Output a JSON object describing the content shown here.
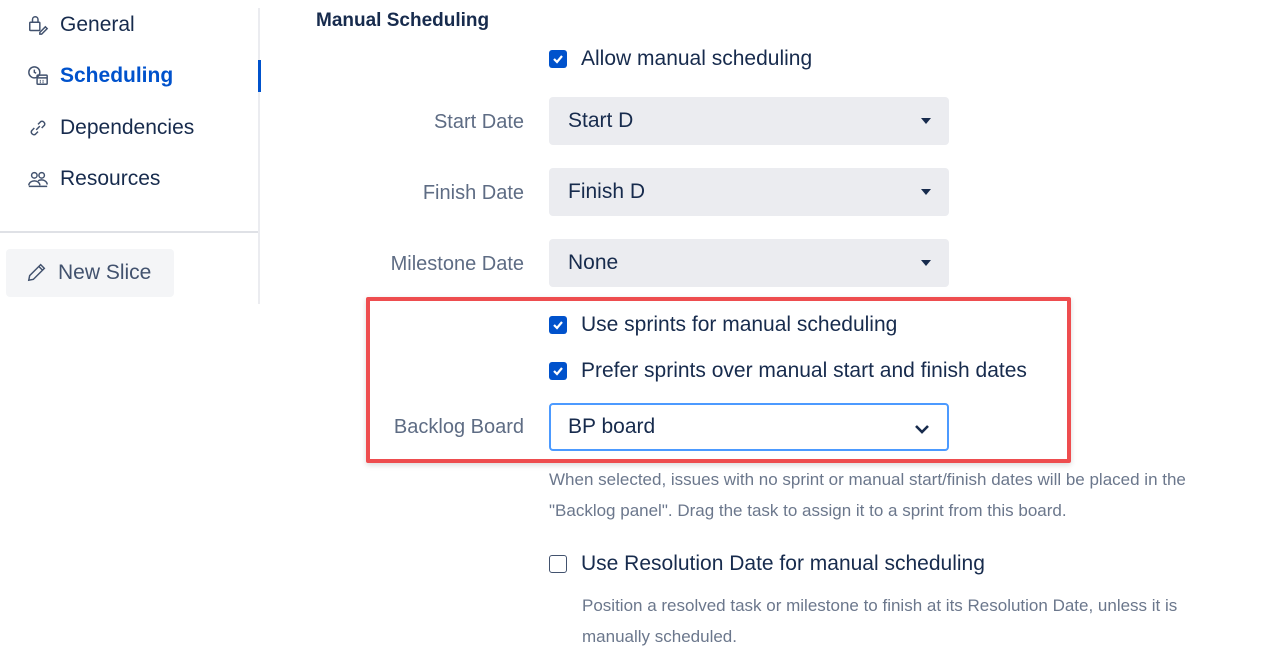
{
  "sidebar": {
    "items": [
      {
        "label": "General",
        "icon": "key-edit-icon"
      },
      {
        "label": "Scheduling",
        "icon": "calendar-clock-icon",
        "active": true
      },
      {
        "label": "Dependencies",
        "icon": "link-icon"
      },
      {
        "label": "Resources",
        "icon": "people-icon"
      }
    ],
    "new_slice_label": "New Slice"
  },
  "main": {
    "section_title": "Manual Scheduling",
    "allow_manual": {
      "label": "Allow manual scheduling",
      "checked": true
    },
    "start_date": {
      "label": "Start Date",
      "value": "Start D"
    },
    "finish_date": {
      "label": "Finish Date",
      "value": "Finish D"
    },
    "milestone_date": {
      "label": "Milestone Date",
      "value": "None"
    },
    "use_sprints": {
      "label": "Use sprints for manual scheduling",
      "checked": true
    },
    "prefer_sprints": {
      "label": "Prefer sprints over manual start and finish dates",
      "checked": true
    },
    "backlog_board": {
      "label": "Backlog Board",
      "value": "BP board"
    },
    "backlog_help": [
      "When selected, issues with no sprint or manual start/finish dates will be placed in the",
      "\"Backlog panel\". Drag the task to assign it to a sprint from this board."
    ],
    "resolution_date": {
      "label": "Use Resolution Date for manual scheduling",
      "checked": false
    },
    "resolution_help": [
      "Position a resolved task or milestone to finish at its Resolution Date, unless it is",
      "manually scheduled."
    ]
  },
  "colors": {
    "accent": "#0052cc",
    "highlight": "#ee4d4f",
    "focus": "#4c9aff"
  }
}
